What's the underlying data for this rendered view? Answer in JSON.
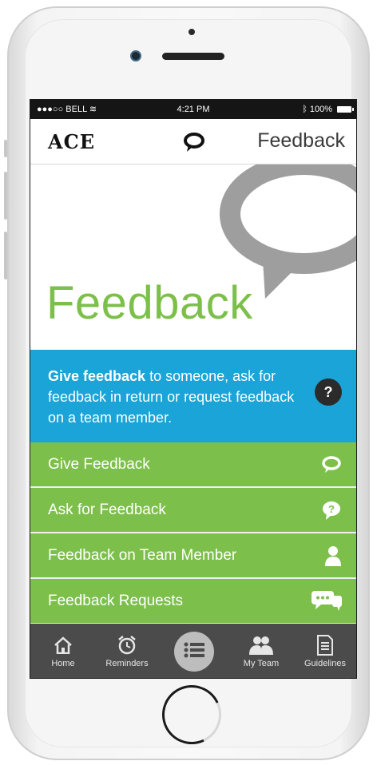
{
  "status_bar": {
    "carrier": "●●●○○ BELL",
    "time": "4:21 PM",
    "battery": "100%"
  },
  "app_bar": {
    "logo": "ACE",
    "title": "Feedback"
  },
  "hero": {
    "title": "Feedback"
  },
  "info": {
    "bold_text": "Give feedback",
    "rest_text": " to someone, ask for feedback in return or request feedback on a team member.",
    "help_label": "?"
  },
  "menu": {
    "items": [
      {
        "label": "Give Feedback",
        "icon": "speech-bubble-icon"
      },
      {
        "label": "Ask for Feedback",
        "icon": "question-bubble-icon"
      },
      {
        "label": "Feedback on Team Member",
        "icon": "person-icon"
      },
      {
        "label": "Feedback Requests",
        "icon": "chat-bubbles-icon"
      }
    ]
  },
  "tab_bar": {
    "tabs": [
      {
        "label": "Home",
        "icon": "home-icon"
      },
      {
        "label": "Reminders",
        "icon": "alarm-clock-icon"
      },
      {
        "label": "",
        "icon": "list-menu-icon"
      },
      {
        "label": "My Team",
        "icon": "team-icon"
      },
      {
        "label": "Guidelines",
        "icon": "document-icon"
      }
    ]
  },
  "colors": {
    "green": "#7cc04b",
    "blue": "#1aa4d8",
    "tab_bar": "#4b4b4b",
    "bubble_gray": "#9e9e9e"
  }
}
